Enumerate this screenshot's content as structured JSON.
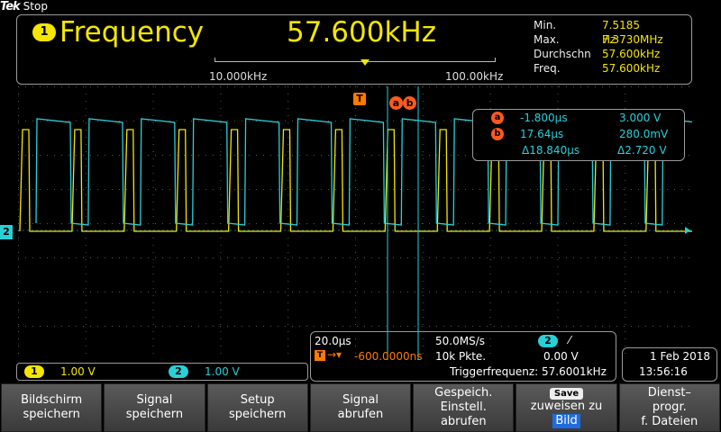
{
  "brand": "Tek",
  "state": "Stop",
  "measurement": {
    "channel": "1",
    "title": "Frequency",
    "value": "57.600kHz",
    "stats": [
      {
        "label": "Min.",
        "value": "7.5185 Hz"
      },
      {
        "label": "Max.",
        "value": "7.3730MHz"
      },
      {
        "label": "Durchschn",
        "value": "57.600kHz"
      },
      {
        "label": "Freq.",
        "value": "57.600kHz"
      }
    ],
    "range_low": "10.000kHz",
    "range_high": "100.00kHz"
  },
  "trigger_flag": "T",
  "cursor_labels": [
    "a",
    "b"
  ],
  "ch2_marker": "2",
  "cursor_readout": [
    {
      "id": "a",
      "time": "-1.800µs",
      "volt": "3.000 V"
    },
    {
      "id": "b",
      "time": "17.64µs",
      "volt": "280.0mV"
    },
    {
      "id": "",
      "time": "Δ18.840µs",
      "volt": "Δ2.720 V"
    }
  ],
  "channels": [
    {
      "id": "1",
      "scale": "1.00 V",
      "color": "#f4e600"
    },
    {
      "id": "2",
      "scale": "1.00 V",
      "color": "#28d0d8"
    }
  ],
  "timebase": {
    "scale": "20.0µs",
    "sample_rate": "50.0MS/s",
    "trig_channel": "2",
    "trig_slope": "⁄",
    "delay": "-600.0000ns",
    "points": "10k Pkte.",
    "trig_level": "0.00 V",
    "trig_freq": "Triggerfrequenz: 57.6001kHz"
  },
  "date": "1 Feb  2018",
  "time": "13:56:16",
  "softkeys": [
    {
      "lines": [
        "Bildschirm",
        "speichern"
      ]
    },
    {
      "lines": [
        "Signal",
        "speichern"
      ]
    },
    {
      "lines": [
        "Setup",
        "speichern"
      ]
    },
    {
      "lines": [
        "Signal",
        "abrufen"
      ]
    },
    {
      "lines": [
        "Gespeich.",
        "Einstell.",
        "abrufen"
      ]
    },
    {
      "pill": "Save",
      "lines": [
        "zuweisen zu",
        "Bild"
      ]
    },
    {
      "lines": [
        "Dienst–",
        "progr.",
        "f. Dateien"
      ]
    }
  ],
  "colors": {
    "ch1": "#f4e600",
    "ch2": "#28d0d8",
    "cursor": "#ff5a1e",
    "trigger": "#ff7a00"
  }
}
